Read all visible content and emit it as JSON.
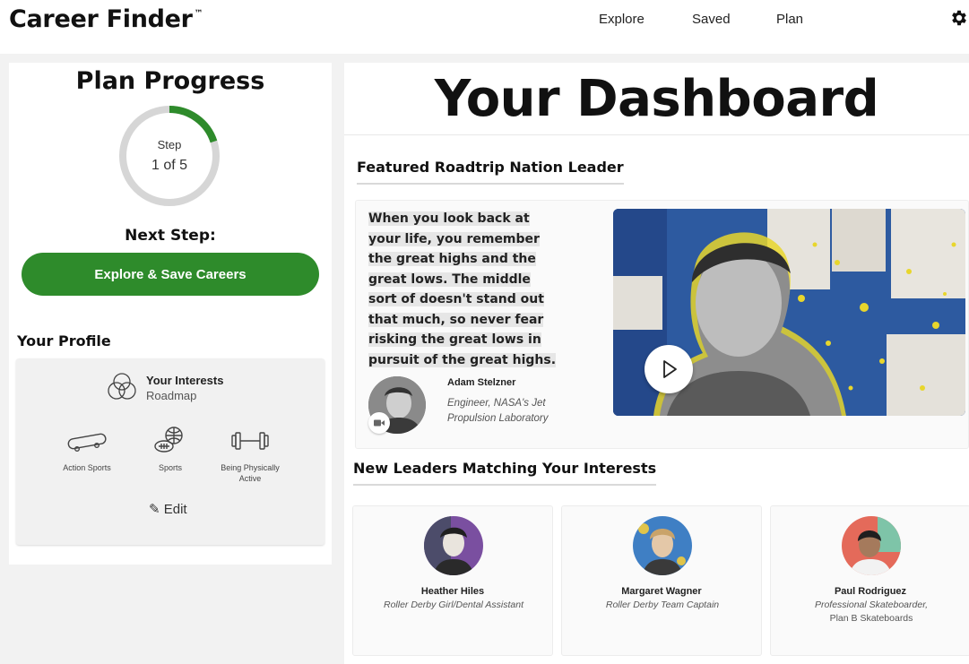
{
  "header": {
    "brand": "Career Finder",
    "trademark": "™",
    "nav": [
      "Explore",
      "Saved",
      "Plan"
    ],
    "settings_icon": "gear-icon"
  },
  "plan": {
    "title": "Plan Progress",
    "step_label": "Step",
    "step_value": "1 of 5",
    "progress_fraction": 0.2,
    "next_step_label": "Next Step:",
    "cta_label": "Explore & Save Careers",
    "accent_color": "#2e8b2b"
  },
  "profile": {
    "title": "Your Profile",
    "interests_title": "Your Interests",
    "interests_sub": "Roadmap",
    "interests": [
      {
        "label": "Action Sports",
        "icon": "skateboard-icon"
      },
      {
        "label": "Sports",
        "icon": "sports-balls-icon"
      },
      {
        "label": "Being Physically Active",
        "icon": "dumbbell-icon"
      }
    ],
    "edit_label": "Edit"
  },
  "dashboard": {
    "title": "Your Dashboard",
    "featured_title": "Featured Roadtrip Nation Leader",
    "quote": "When you look back at your life, you remember the great highs and the great lows. The middle sort of doesn't stand out that much, so never fear risking the great lows in pursuit of the great highs.",
    "featured_leader": {
      "name": "Adam Stelzner",
      "role": "Engineer, NASA's Jet Propulsion Laboratory"
    },
    "matching_title": "New Leaders Matching Your Interests",
    "leaders": [
      {
        "name": "Heather Hiles",
        "role": "Roller Derby Girl/Dental Assistant",
        "org": ""
      },
      {
        "name": "Margaret Wagner",
        "role": "Roller Derby Team Captain",
        "org": ""
      },
      {
        "name": "Paul Rodriguez",
        "role": "Professional Skateboarder,",
        "org": "Plan B Skateboards"
      }
    ]
  }
}
